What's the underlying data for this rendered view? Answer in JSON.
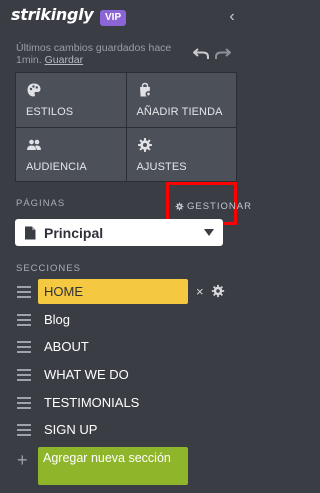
{
  "header": {
    "logo_text": "strikingly",
    "badge": "VIP",
    "collapse_glyph": "‹",
    "save_note": "Últimos cambios guardados hace 1min.",
    "save_link": "Guardar"
  },
  "tiles": [
    {
      "label": "ESTILOS",
      "icon": "palette-icon"
    },
    {
      "label": "AÑADIR TIENDA",
      "icon": "shopping-bag-icon"
    },
    {
      "label": "AUDIENCIA",
      "icon": "users-icon"
    },
    {
      "label": "AJUSTES",
      "icon": "gear-icon"
    }
  ],
  "pages": {
    "heading": "PÁGINAS",
    "manage_label": "GESTIONAR",
    "selected_page": "Principal"
  },
  "sections": {
    "heading": "SECCIONES",
    "items": [
      "HOME",
      "Blog",
      "ABOUT",
      "WHAT WE DO",
      "TESTIMONIALS",
      "SIGN UP"
    ],
    "add_label": "Agregar nueva sección",
    "remove_glyph": "×",
    "add_glyph": "+"
  },
  "colors": {
    "background": "#3a3d44",
    "tile": "#4c5058",
    "vip": "#8b64d6",
    "active_section": "#f4c840",
    "add_button": "#8fb52a",
    "highlight_box": "#ff0000"
  }
}
